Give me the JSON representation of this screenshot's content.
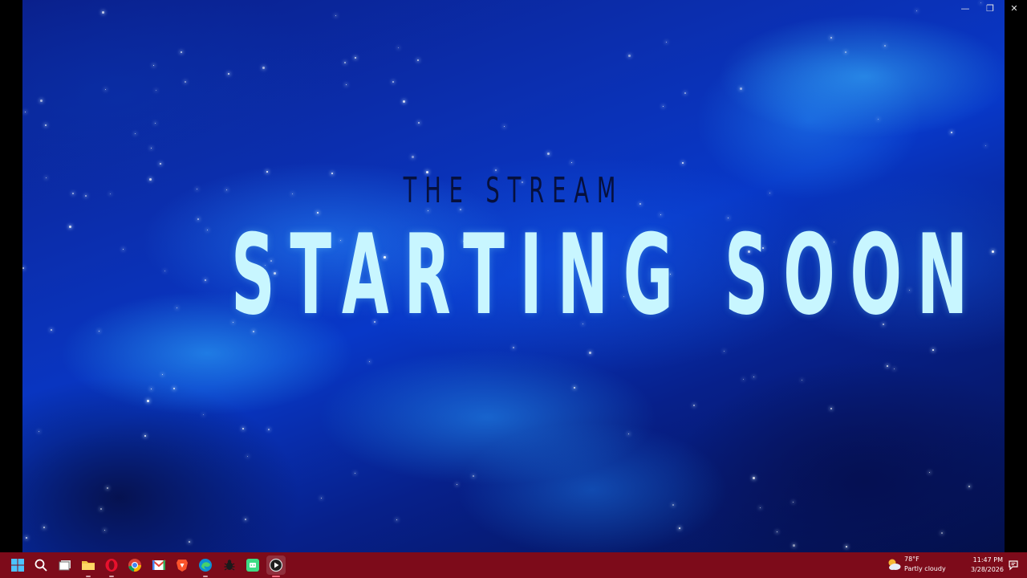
{
  "overlay": {
    "subtitle": "THE STREAM",
    "title": "STARTING SOON"
  },
  "window_controls": {
    "minimize": "—",
    "restore": "❐",
    "close": "✕"
  },
  "taskbar": {
    "apps": [
      {
        "name": "start",
        "icon": "windows-logo-icon"
      },
      {
        "name": "search",
        "icon": "search-icon"
      },
      {
        "name": "task-view",
        "icon": "task-view-icon"
      },
      {
        "name": "file-explorer",
        "icon": "folder-icon"
      },
      {
        "name": "opera",
        "icon": "opera-icon"
      },
      {
        "name": "chrome",
        "icon": "chrome-icon"
      },
      {
        "name": "gmail",
        "icon": "gmail-icon"
      },
      {
        "name": "brave",
        "icon": "brave-icon"
      },
      {
        "name": "edge",
        "icon": "edge-icon"
      },
      {
        "name": "app-bug",
        "icon": "bug-icon"
      },
      {
        "name": "app-green",
        "icon": "green-app-icon"
      },
      {
        "name": "media-player",
        "icon": "play-icon"
      }
    ],
    "weather": {
      "temp": "78°F",
      "condition": "Partly cloudy",
      "icon": "partly-cloudy-icon"
    },
    "clock": {
      "time": "11:47 PM",
      "date": "3/28/2026"
    },
    "colors": {
      "taskbar_bg": "#7d0b1a",
      "title_color": "#c8f6ff",
      "subtitle_color": "#06103d"
    }
  }
}
